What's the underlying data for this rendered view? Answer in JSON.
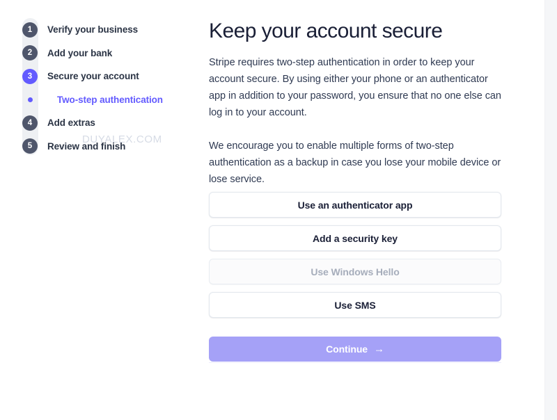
{
  "stepper": {
    "steps": [
      {
        "marker": "1",
        "label": "Verify your business",
        "state": "upcoming"
      },
      {
        "marker": "2",
        "label": "Add your bank",
        "state": "upcoming"
      },
      {
        "marker": "3",
        "label": "Secure your account",
        "state": "current"
      },
      {
        "marker": "4",
        "label": "Add extras",
        "state": "upcoming"
      },
      {
        "marker": "5",
        "label": "Review and finish",
        "state": "upcoming"
      }
    ],
    "substep": {
      "icon": "bullet-dot-icon",
      "label": "Two-step authentication"
    }
  },
  "content": {
    "title": "Keep your account secure",
    "paragraph_1": "Stripe requires two-step authentication in order to keep your account secure. By using either your phone or an authenticator app in addition to your password, you ensure that no one else can log in to your account.",
    "paragraph_2": "We encourage you to enable multiple forms of two-step authentication as a backup in case you lose your mobile device or lose service."
  },
  "watermark": {
    "text": "DUYALEX.COM"
  },
  "options": [
    {
      "label": "Use an authenticator app",
      "disabled": false
    },
    {
      "label": "Add a security key",
      "disabled": false
    },
    {
      "label": "Use Windows Hello",
      "disabled": true
    },
    {
      "label": "Use SMS",
      "disabled": false
    }
  ],
  "continue": {
    "label": "Continue",
    "icon": "arrow-right-icon",
    "glyph": "→"
  },
  "colors": {
    "brand_purple": "#635bff",
    "continue_button": "#a5a1f7",
    "step_marker": "#4f566b",
    "heading": "#1a1f36",
    "body_text": "#2f3a52",
    "disabled_text": "#a6adbb",
    "track": "#eef0f3",
    "scrollbar_track": "#f5f6f8"
  }
}
